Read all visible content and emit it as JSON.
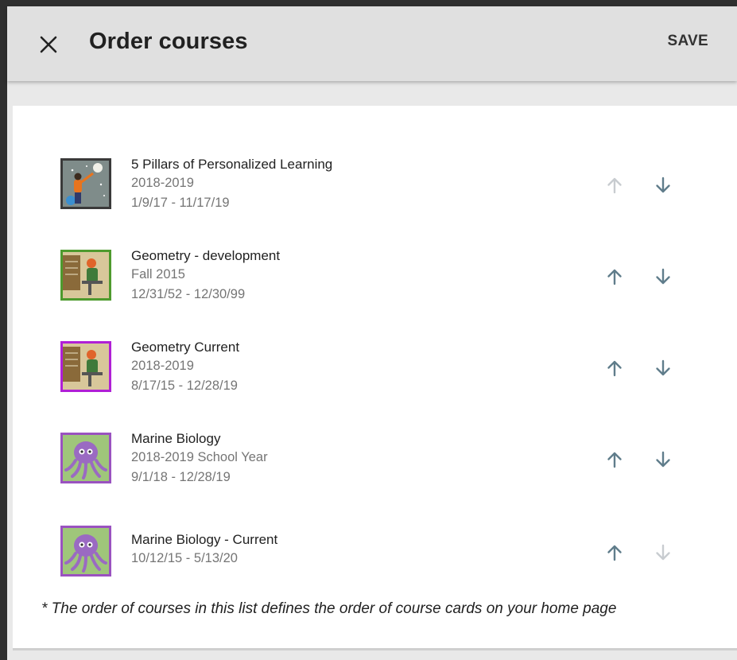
{
  "header": {
    "title": "Order courses",
    "save_label": "SAVE",
    "close_icon": "close-icon"
  },
  "courses": [
    {
      "name": "5 Pillars of Personalized Learning",
      "term": "2018-2019",
      "dates": "1/9/17 - 11/17/19",
      "thumb_border": "#3a3a3a",
      "can_move_up": false,
      "can_move_down": true
    },
    {
      "name": "Geometry - development",
      "term": "Fall 2015",
      "dates": "12/31/52 - 12/30/99",
      "thumb_border": "#4e9a2e",
      "can_move_up": true,
      "can_move_down": true
    },
    {
      "name": "Geometry Current",
      "term": "2018-2019",
      "dates": "8/17/15 - 12/28/19",
      "thumb_border": "#b01fd6",
      "can_move_up": true,
      "can_move_down": true
    },
    {
      "name": "Marine Biology",
      "term": "2018-2019 School Year",
      "dates": "9/1/18 - 12/28/19",
      "thumb_border": "#9a52c0",
      "can_move_up": true,
      "can_move_down": true
    },
    {
      "name": "Marine Biology - Current",
      "term": "10/12/15 - 5/13/20",
      "dates": "",
      "thumb_border": "#9a52c0",
      "can_move_up": true,
      "can_move_down": false
    }
  ],
  "footnote": "* The order of courses in this list defines the order of course cards on your home page",
  "colors": {
    "arrow_active": "#607d8b",
    "arrow_disabled": "#c8ccd0",
    "appbar_bg": "#e0e0e0"
  }
}
